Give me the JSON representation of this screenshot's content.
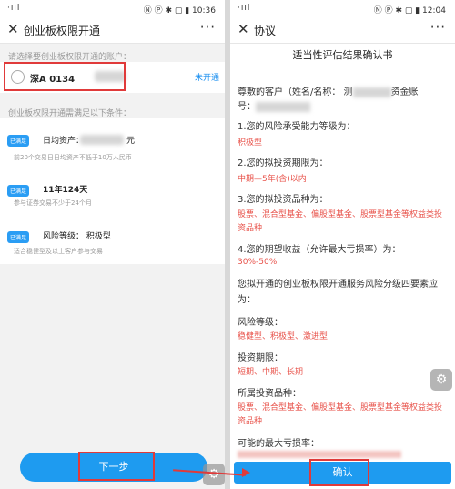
{
  "left": {
    "status": {
      "signal": "·ııl",
      "right_icons_time": "Ⓝ Ⓟ ✱ ▢ ▮ 10:36"
    },
    "nav": {
      "close": "✕",
      "title": "创业板权限开通",
      "more": "···"
    },
    "account_hint": "请选择要创业板权限开通的账户：",
    "account": {
      "label": "深A  0134",
      "status": "未开通"
    },
    "conditions_hint": "创业板权限开通需满足以下条件：",
    "conditions": [
      {
        "badge": "已满足",
        "title": "日均资产：",
        "suffix": "元",
        "sub": "前20个交易日日均资产不低于10万人民币"
      },
      {
        "badge": "已满足",
        "title": "11年124天",
        "suffix": "",
        "sub": "参与证券交易不少于24个月"
      },
      {
        "badge": "已满足",
        "title": "风险等级： 积极型",
        "suffix": "",
        "sub": "适合稳健型及以上客户参与交易"
      }
    ],
    "next_button": "下一步",
    "gear": "⚙"
  },
  "right": {
    "status": {
      "signal": "·ııl",
      "right_icons_time": "Ⓝ Ⓟ ✱ ▢ ▮ 12:04"
    },
    "nav": {
      "close": "✕",
      "title": "协议",
      "more": "···"
    },
    "doc_title": "适当性评估结果确认书",
    "greeting_start": "尊敷的客户（姓名/名称： 测",
    "greeting_end": "资金账",
    "greeting_line2": "号：",
    "q1": "1.您的风险承受能力等级为：",
    "a1": "积极型",
    "q2": "2.您的拟投资期限为：",
    "a2": "中期—5年(含)以内",
    "q3": "3.您的拟投资品种为：",
    "a3": "股票、混合型基金、偏股型基金、股票型基金等权益类投资品种",
    "q4": "4.您的期望收益（允许最大亏损率）为：",
    "a4": "30%-50%",
    "intro": "您拟开通的创业板权限开通服务风险分级四要素应为：",
    "h1": "风险等级：",
    "v1": "稳健型、积极型、激进型",
    "h2": "投资期限：",
    "v2": "短期、中期、长期",
    "h3": "所属投资品种：",
    "v3": "股票、混合型基金、偏股型基金、股票型基金等权益类投资品种",
    "h4": "可能的最大亏损率：",
    "confirm_button": "确认",
    "gear": "⚙"
  },
  "colors": {
    "accent": "#1e9bf0",
    "highlight": "#e03a3a",
    "answer": "#e8534b"
  }
}
